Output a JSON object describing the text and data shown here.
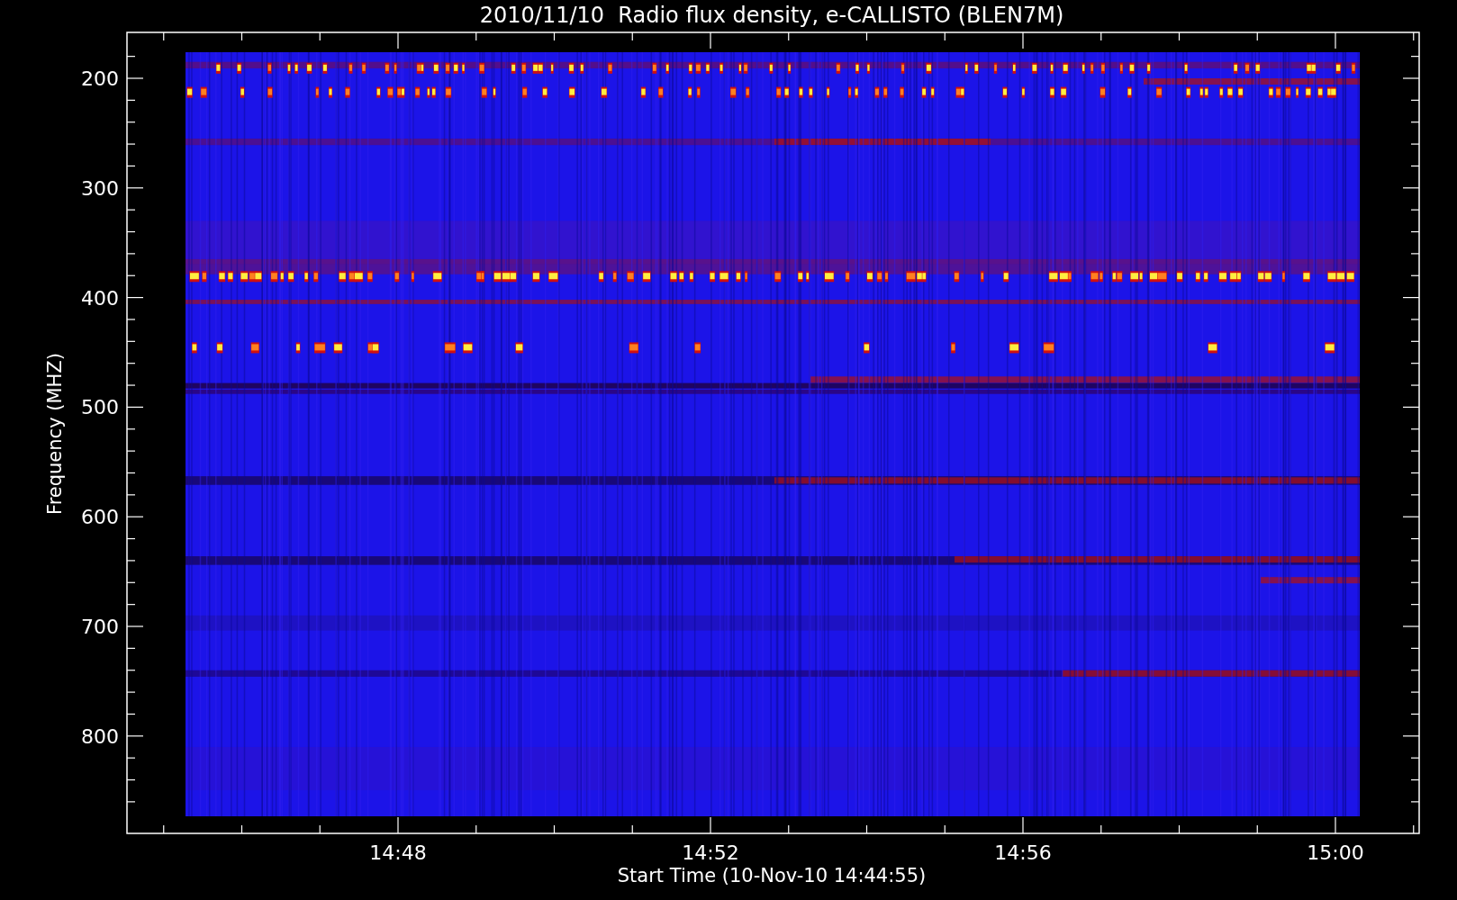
{
  "title": "2010/11/10  Radio flux density, e-CALLISTO (BLEN7M)",
  "y_axis": {
    "label": "Frequency (MHZ)",
    "ticks": [
      "200",
      "300",
      "400",
      "500",
      "600",
      "700",
      "800"
    ]
  },
  "x_axis": {
    "label": "Start Time (10-Nov-10 14:44:55)",
    "ticks": [
      "14:48",
      "14:52",
      "14:56",
      "15:00"
    ]
  }
}
